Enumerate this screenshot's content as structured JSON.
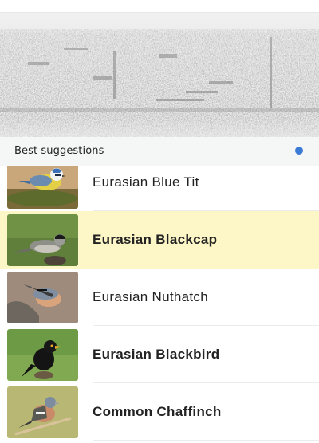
{
  "suggestions": {
    "header": "Best suggestions",
    "indicator_color": "#3a7bd5",
    "items": [
      {
        "name": "Eurasian Blue Tit",
        "emphasis": false,
        "selected": false,
        "image": "blue-tit-photo"
      },
      {
        "name": "Eurasian Blackcap",
        "emphasis": true,
        "selected": true,
        "image": "blackcap-photo"
      },
      {
        "name": "Eurasian Nuthatch",
        "emphasis": false,
        "selected": false,
        "image": "nuthatch-photo"
      },
      {
        "name": "Eurasian Blackbird",
        "emphasis": true,
        "selected": false,
        "image": "blackbird-photo"
      },
      {
        "name": "Common Chaffinch",
        "emphasis": true,
        "selected": false,
        "image": "chaffinch-photo"
      }
    ]
  }
}
